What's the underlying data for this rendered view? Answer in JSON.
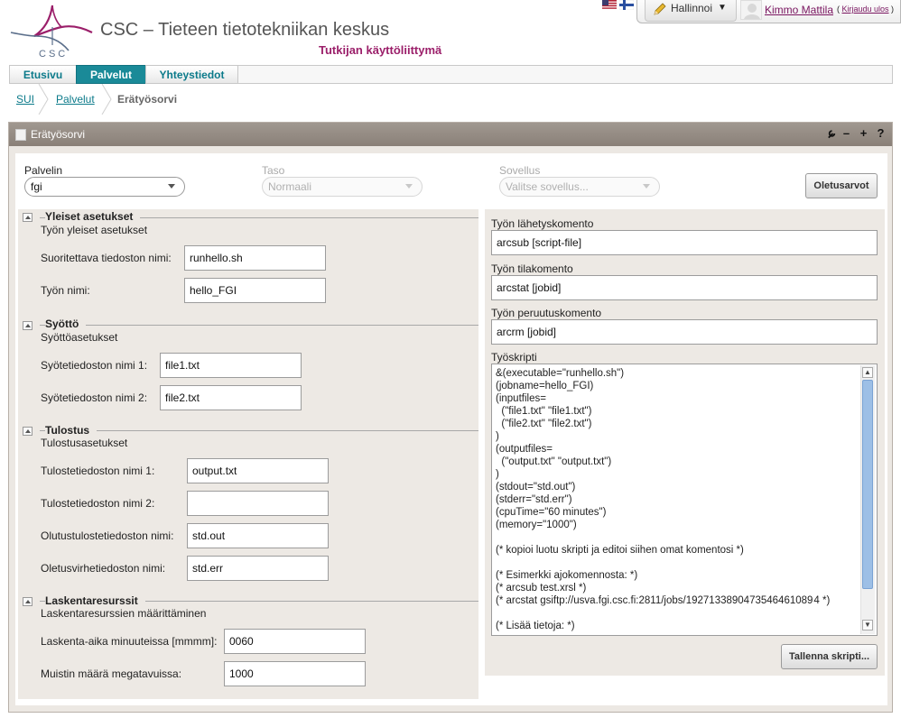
{
  "header": {
    "title": "CSC – Tieteen tietotekniikan keskus",
    "subtitle": "Tutkijan käyttöliittymä",
    "logo_text": "CSC",
    "manage_label": "Hallinnoi",
    "user_name": "Kimmo Mattila",
    "logout_label": "Kirjaudu ulos",
    "languages": [
      "english-flag-icon",
      "finnish-flag-icon"
    ]
  },
  "nav": {
    "tabs": [
      {
        "label": "Etusivu",
        "active": false
      },
      {
        "label": "Palvelut",
        "active": true
      },
      {
        "label": "Yhteystiedot",
        "active": false
      }
    ]
  },
  "breadcrumb": {
    "items": [
      "SUI",
      "Palvelut",
      "Erätyösorvi"
    ]
  },
  "panel": {
    "title": "Erätyösorvi",
    "tools": [
      "wrench-icon",
      "minimize-icon",
      "maximize-icon",
      "help-icon"
    ]
  },
  "selectors": {
    "server_label": "Palvelin",
    "server_value": "fgi",
    "level_label": "Taso",
    "level_value": "Normaali",
    "app_label": "Sovellus",
    "app_value": "Valitse sovellus...",
    "defaults_button": "Oletusarvot"
  },
  "sections": {
    "general": {
      "title": "Yleiset asetukset",
      "subtitle": "Työn yleiset asetukset",
      "fields": [
        {
          "label": "Suoritettava tiedoston nimi:",
          "value": "runhello.sh"
        },
        {
          "label": "Työn nimi:",
          "value": "hello_FGI"
        }
      ]
    },
    "input": {
      "title": "Syöttö",
      "subtitle": "Syöttöasetukset",
      "fields": [
        {
          "label": "Syötetiedoston nimi 1:",
          "value": "file1.txt"
        },
        {
          "label": "Syötetiedoston nimi 2:",
          "value": "file2.txt"
        }
      ]
    },
    "output": {
      "title": "Tulostus",
      "subtitle": "Tulostusasetukset",
      "fields": [
        {
          "label": "Tulostetiedoston nimi 1:",
          "value": "output.txt"
        },
        {
          "label": "Tulostetiedoston nimi 2:",
          "value": ""
        },
        {
          "label": "Olutustulostetiedoston nimi:",
          "value": "std.out"
        },
        {
          "label": "Oletusvirhetiedoston nimi:",
          "value": "std.err"
        }
      ]
    },
    "resources": {
      "title": "Laskentaresurssit",
      "subtitle": "Laskentaresurssien määrittäminen",
      "fields": [
        {
          "label": "Laskenta-aika minuuteissa [mmmm]:",
          "value": "0060"
        },
        {
          "label": "Muistin määrä megatavuissa:",
          "value": "1000"
        }
      ]
    }
  },
  "commands": {
    "submit_label": "Työn lähetyskomento",
    "submit_value": "arcsub [script-file]",
    "status_label": "Työn tilakomento",
    "status_value": "arcstat [jobid]",
    "cancel_label": "Työn peruutuskomento",
    "cancel_value": "arcrm [jobid]",
    "script_label": "Työskripti",
    "script_text": "&(executable=\"runhello.sh\")\n(jobname=hello_FGI)\n(inputfiles=\n  (\"file1.txt\" \"file1.txt\")\n  (\"file2.txt\" \"file2.txt\")\n)\n(outputfiles=\n  (\"output.txt\" \"output.txt\")\n)\n(stdout=\"std.out\")\n(stderr=\"std.err\")\n(cpuTime=\"60 minutes\")\n(memory=\"1000\")\n\n(* kopioi luotu skripti ja editoi siihen omat komentosi *)\n\n(* Esimerkki ajokomennosta: *)\n(* arcsub test.xrsl *)\n(* arcstat gsiftp://usva.fgi.csc.fi:2811/jobs/1927133890473546461089 4 *)\n\n(* Lisää tietoja: *)",
    "save_button": "Tallenna skripti..."
  },
  "colors": {
    "brand_purple": "#9b1f6a",
    "tab_active": "#1a8a98",
    "link_teal": "#0b7a8a",
    "panel_header": "#958c84"
  }
}
